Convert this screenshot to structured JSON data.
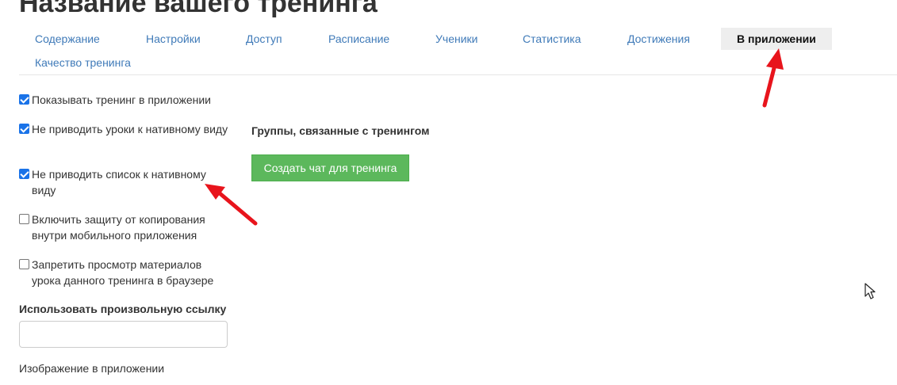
{
  "page": {
    "title": "Название вашего тренинга"
  },
  "tabs": [
    {
      "label": "Содержание",
      "active": false
    },
    {
      "label": "Настройки",
      "active": false
    },
    {
      "label": "Доступ",
      "active": false
    },
    {
      "label": "Расписание",
      "active": false
    },
    {
      "label": "Ученики",
      "active": false
    },
    {
      "label": "Статистика",
      "active": false
    },
    {
      "label": "Достижения",
      "active": false
    },
    {
      "label": "В приложении",
      "active": true
    },
    {
      "label": "Качество тренинга",
      "active": false
    }
  ],
  "options": [
    {
      "label": "Показывать тренинг в приложении",
      "checked": true
    },
    {
      "label": "Не приводить уроки к нативному виду",
      "checked": true
    },
    {
      "label": "Не приводить список к нативному виду",
      "checked": true
    },
    {
      "label": "Включить защиту от копирования внутри мобильного приложения",
      "checked": false
    },
    {
      "label": "Запретить просмотр материалов урока данного тренинга в браузере",
      "checked": false
    }
  ],
  "custom_link": {
    "label": "Использовать произвольную ссылку",
    "value": ""
  },
  "image_section": {
    "label": "Изображение в приложении"
  },
  "groups": {
    "heading": "Группы, связанные с тренингом",
    "create_chat_label": "Создать чат для тренинга"
  },
  "colors": {
    "link": "#3f7ab8",
    "active_tab_bg": "#eeeeee",
    "checkbox_checked": "#1a73e8",
    "button_green": "#5cb85c",
    "annotation_arrow": "#e8141c"
  },
  "icons": {
    "arrow_annotation": "red-arrow-annotation",
    "cursor": "mouse-pointer-icon"
  }
}
